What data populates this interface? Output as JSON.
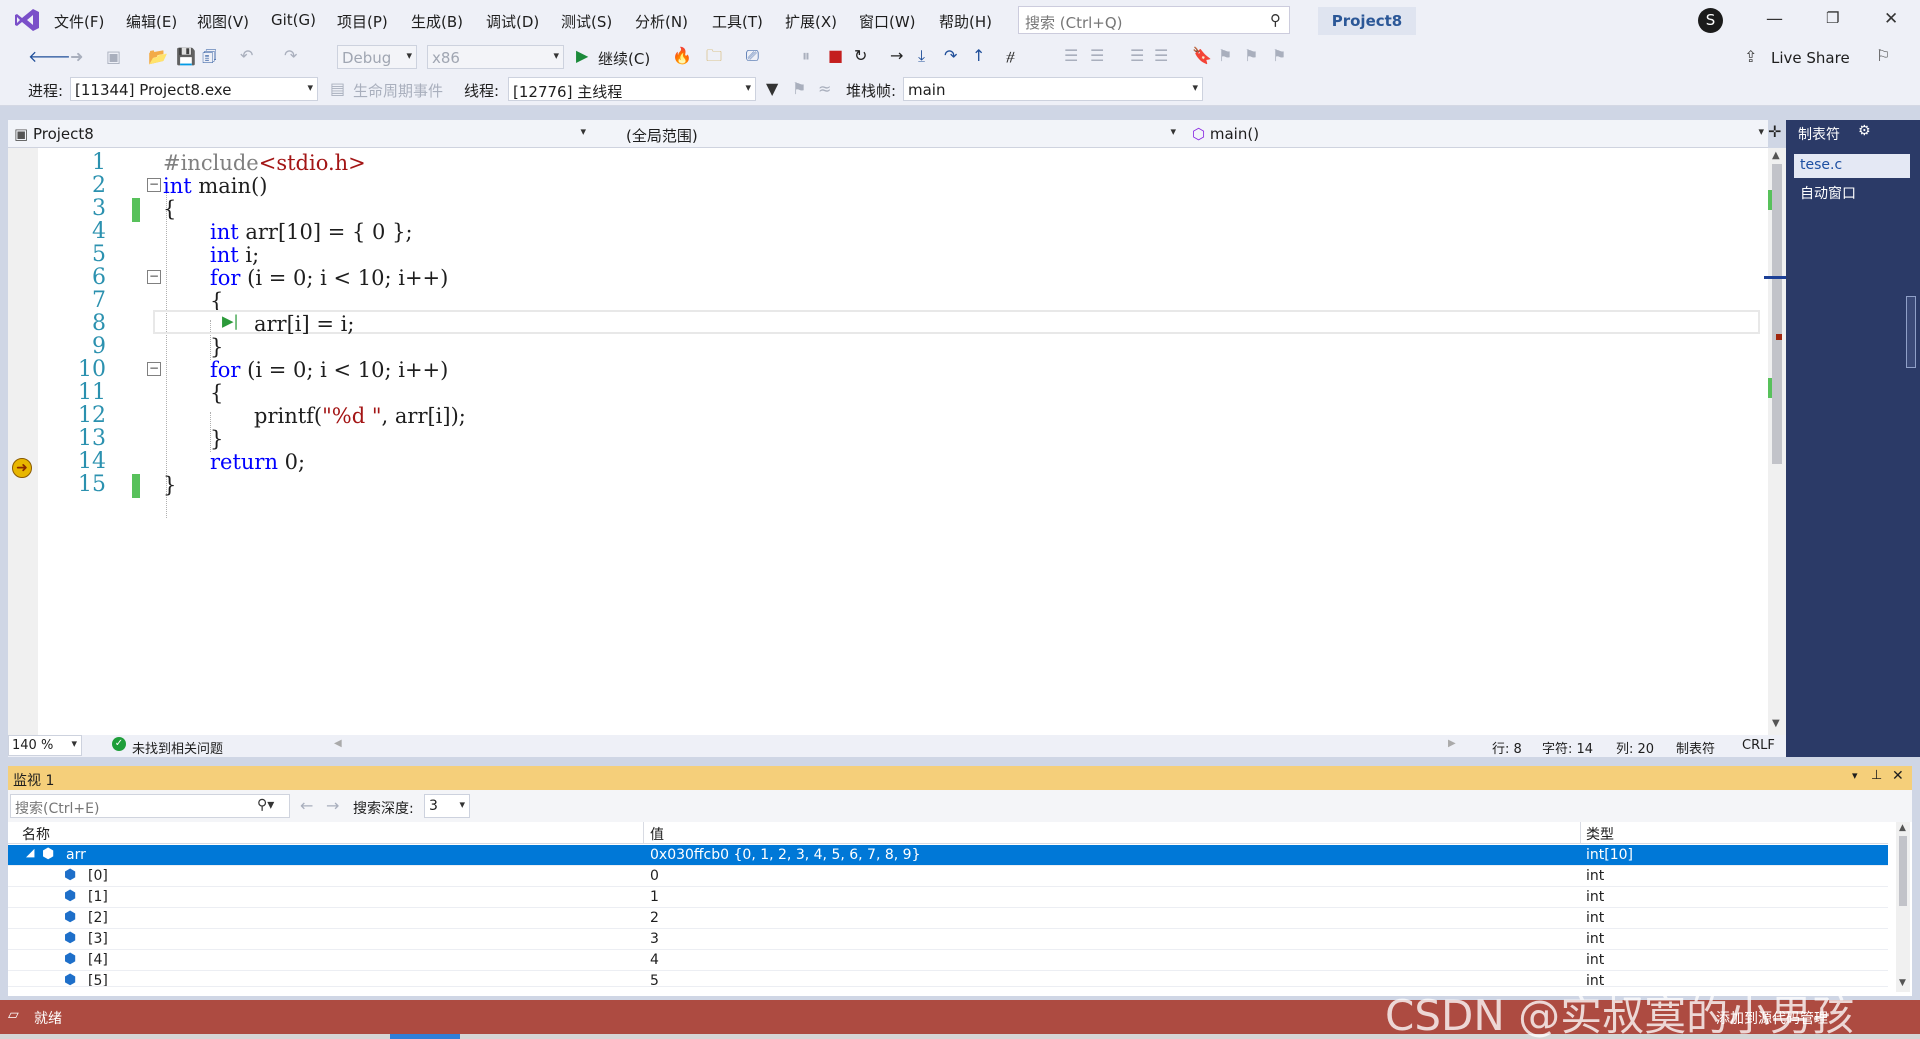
{
  "menu": [
    "文件(F)",
    "编辑(E)",
    "视图(V)",
    "Git(G)",
    "项目(P)",
    "生成(B)",
    "调试(D)",
    "测试(S)",
    "分析(N)",
    "工具(T)",
    "扩展(X)",
    "窗口(W)",
    "帮助(H)"
  ],
  "search": {
    "placeholder": "搜索 (Ctrl+Q)"
  },
  "project_name": "Project8",
  "avatar": "S",
  "toolbar": {
    "config": "Debug",
    "platform": "x86",
    "continue": "继续(C)",
    "live_share": "Live Share"
  },
  "debugbar": {
    "process_label": "进程:",
    "process_value": "[11344] Project8.exe",
    "lifecycle": "生命周期事件",
    "thread_label": "线程:",
    "thread_value": "[12776] 主线程",
    "stack_label": "堆栈帧:",
    "stack_value": "main"
  },
  "nav": {
    "project": "Project8",
    "scope": "(全局范围)",
    "function": "main()"
  },
  "code": {
    "line_numbers": [
      "1",
      "2",
      "3",
      "4",
      "5",
      "6",
      "7",
      "8",
      "9",
      "10",
      "11",
      "12",
      "13",
      "14",
      "15"
    ],
    "l1_pp": "#include",
    "l1_hdr": "<stdio.h>",
    "l2_kw": "int",
    "l2_rest": " main()",
    "l3": "{",
    "l4_kw": "int",
    "l4_rest": " arr[10] = { 0 };",
    "l5_kw": "int",
    "l5_rest": " i;",
    "l6_kw": "for",
    "l6_rest": " (i = 0; i < 10; i++)",
    "l7": "{",
    "l8": "arr[i] = i;",
    "l9": "}",
    "l10_kw": "for",
    "l10_rest": " (i = 0; i < 10; i++)",
    "l11": "{",
    "l12_fn": "printf(",
    "l12_str": "\"%d \"",
    "l12_rest": ", arr[i]);",
    "l13": "}",
    "l14_kw": "return",
    "l14_rest": " 0;",
    "l15": "}"
  },
  "status": {
    "zoom": "140 %",
    "issues": "未找到相关问题",
    "row": "行: 8",
    "char": "字符: 14",
    "col": "列: 20",
    "tabs": "制表符",
    "eol": "CRLF"
  },
  "right_panel": {
    "title": "制表符",
    "items": [
      "tese.c",
      "自动窗口"
    ]
  },
  "watch": {
    "title": "监视 1",
    "search_placeholder": "搜索(Ctrl+E)",
    "depth_label": "搜索深度:",
    "depth_value": "3",
    "columns": [
      "名称",
      "值",
      "类型"
    ],
    "rows": [
      {
        "name": "arr",
        "value": "0x030ffcb0 {0, 1, 2, 3, 4, 5, 6, 7, 8, 9}",
        "type": "int[10]"
      },
      {
        "name": "[0]",
        "value": "0",
        "type": "int"
      },
      {
        "name": "[1]",
        "value": "1",
        "type": "int"
      },
      {
        "name": "[2]",
        "value": "2",
        "type": "int"
      },
      {
        "name": "[3]",
        "value": "3",
        "type": "int"
      },
      {
        "name": "[4]",
        "value": "4",
        "type": "int"
      },
      {
        "name": "[5]",
        "value": "5",
        "type": "int"
      }
    ]
  },
  "bottom": {
    "status": "就绪",
    "scm": "添加到源代码管理"
  },
  "watermark": "CSDN @实叔寞的小男孩",
  "colors": {
    "accent": "#0078d7",
    "statusbar": "#ad4b41",
    "watch_header": "#f5cf7a",
    "keyword": "#0000ff",
    "string": "#a31515",
    "line_number": "#2b91af"
  }
}
